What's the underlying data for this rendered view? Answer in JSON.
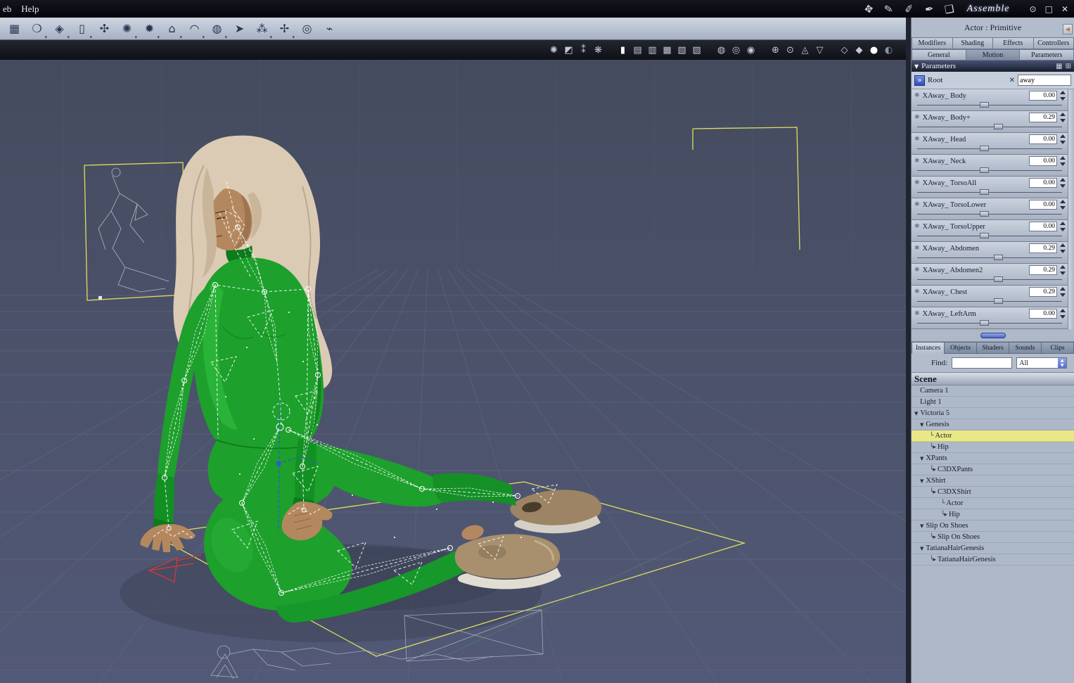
{
  "menubar": {
    "menu_web": "eb",
    "menu_help": "Help",
    "room_label": "Assemble",
    "tools": [
      {
        "name": "hand-tool-icon",
        "glyph": "✥"
      },
      {
        "name": "spray-tool-icon",
        "glyph": "✎"
      },
      {
        "name": "brush-tool-icon",
        "glyph": "✐"
      },
      {
        "name": "pen-tool-icon",
        "glyph": "✒"
      },
      {
        "name": "sheet-tool-icon",
        "glyph": "❏"
      }
    ],
    "window_controls": [
      {
        "name": "eye-icon",
        "glyph": "⊙"
      },
      {
        "name": "maximize-icon",
        "glyph": "□"
      },
      {
        "name": "close-icon",
        "glyph": "✕"
      }
    ]
  },
  "toolbar": {
    "icons": [
      {
        "name": "insert-object-icon",
        "glyph": "▦"
      },
      {
        "name": "insert-sphere-icon",
        "glyph": "❍"
      },
      {
        "name": "insert-gem-icon",
        "glyph": "◈"
      },
      {
        "name": "insert-cylinder-icon",
        "glyph": "▯"
      },
      {
        "name": "insert-hand-icon",
        "glyph": "✣"
      },
      {
        "name": "insert-urchin-icon",
        "glyph": "✺"
      },
      {
        "name": "insert-star-icon",
        "glyph": "✹"
      },
      {
        "name": "insert-terrain-icon",
        "glyph": "⌂"
      },
      {
        "name": "insert-shell-icon",
        "glyph": "◠"
      },
      {
        "name": "insert-blob-icon",
        "glyph": "◍"
      },
      {
        "name": "insert-arrow-icon",
        "glyph": "➤"
      },
      {
        "name": "insert-spray-icon",
        "glyph": "⁂"
      },
      {
        "name": "insert-particle-icon",
        "glyph": "✢"
      },
      {
        "name": "insert-target-icon",
        "glyph": "◎"
      },
      {
        "name": "insert-bone-icon",
        "glyph": "⌁"
      }
    ]
  },
  "viewport_bar": {
    "icons": [
      {
        "name": "light-preview-icon",
        "glyph": "✺"
      },
      {
        "name": "sound-preview-icon",
        "glyph": "◩"
      },
      {
        "name": "aa-preview-icon",
        "glyph": "⁑"
      },
      {
        "name": "effects-preview-icon",
        "glyph": "❋"
      },
      {
        "name": "display-box-icon",
        "glyph": "▮"
      },
      {
        "name": "display-wire-icon",
        "glyph": "▤"
      },
      {
        "name": "display-lines-icon",
        "glyph": "▥"
      },
      {
        "name": "display-flat-icon",
        "glyph": "▦"
      },
      {
        "name": "display-gouraud-icon",
        "glyph": "▧"
      },
      {
        "name": "display-textured-icon",
        "glyph": "▨"
      },
      {
        "name": "shader-ball-icon",
        "glyph": "◍"
      },
      {
        "name": "shader-wire-icon",
        "glyph": "◎"
      },
      {
        "name": "shader-solid-icon",
        "glyph": "◉"
      },
      {
        "name": "camera-orbit-icon",
        "glyph": "⊕"
      },
      {
        "name": "camera-pan-icon",
        "glyph": "⊙"
      },
      {
        "name": "camera-dolly-icon",
        "glyph": "◬"
      },
      {
        "name": "camera-bank-icon",
        "glyph": "▽"
      },
      {
        "name": "draw-cube-wire-icon",
        "glyph": "◇"
      },
      {
        "name": "draw-cube-solid-icon",
        "glyph": "◆"
      },
      {
        "name": "draw-sphere-white-icon",
        "glyph": "●"
      },
      {
        "name": "draw-sphere-gray-icon",
        "glyph": "◐"
      }
    ]
  },
  "panel": {
    "title": "Actor : Primitive",
    "tabs_top": [
      {
        "label": "Modifiers"
      },
      {
        "label": "Shading"
      },
      {
        "label": "Effects"
      },
      {
        "label": "Controllers"
      }
    ],
    "tabs_sub": [
      {
        "label": "General"
      },
      {
        "label": "Motion"
      },
      {
        "label": "Parameters"
      }
    ],
    "parameters_header": "Parameters",
    "header_icons": [
      {
        "name": "grid-view-icon",
        "glyph": "▦"
      },
      {
        "name": "add-parameter-icon",
        "glyph": "⊞"
      }
    ],
    "root_label": "Root",
    "collapse_all_glyph": "»",
    "clear_glyph": "✕",
    "param_search_value": "away",
    "params": [
      {
        "name": "XAway_ Body",
        "value": "0.00",
        "slider_pos": 0.46
      },
      {
        "name": "XAway_ Body+",
        "value": "0.29",
        "slider_pos": 0.56
      },
      {
        "name": "XAway_ Head",
        "value": "0.00",
        "slider_pos": 0.46
      },
      {
        "name": "XAway_ Neck",
        "value": "0.00",
        "slider_pos": 0.46
      },
      {
        "name": "XAway_ TorsoAll",
        "value": "0.00",
        "slider_pos": 0.46
      },
      {
        "name": "XAway_ TorsoLower",
        "value": "0.00",
        "slider_pos": 0.46
      },
      {
        "name": "XAway_ TorsoUpper",
        "value": "0.00",
        "slider_pos": 0.46
      },
      {
        "name": "XAway_ Abdomen",
        "value": "0.29",
        "slider_pos": 0.56
      },
      {
        "name": "XAway_ Abdomen2",
        "value": "0.29",
        "slider_pos": 0.56
      },
      {
        "name": "XAway_ Chest",
        "value": "0.29",
        "slider_pos": 0.56
      },
      {
        "name": "XAway_ LeftArm",
        "value": "0.00",
        "slider_pos": 0.46
      }
    ],
    "browser_tabs": [
      {
        "label": "Instances"
      },
      {
        "label": "Objects"
      },
      {
        "label": "Shaders"
      },
      {
        "label": "Sounds"
      },
      {
        "label": "Clips"
      }
    ],
    "find_label": "Find:",
    "filter_value": "All",
    "scene_label": "Scene",
    "tree": [
      {
        "label": "Camera 1"
      },
      {
        "label": "Light 1"
      },
      {
        "label": "Victoria 5"
      },
      {
        "label": "Genesis"
      },
      {
        "label": "Actor",
        "selected": true
      },
      {
        "label": "Hip"
      },
      {
        "label": "XPants"
      },
      {
        "label": "C3DXPants"
      },
      {
        "label": "XShirt"
      },
      {
        "label": "C3DXShirt"
      },
      {
        "label": "Actor"
      },
      {
        "label": "Hip"
      },
      {
        "label": "Slip On Shoes"
      },
      {
        "label": "Slip On Shoes"
      },
      {
        "label": "TatianaHairGenesis"
      },
      {
        "label": "TatianaHairGenesis"
      }
    ]
  }
}
